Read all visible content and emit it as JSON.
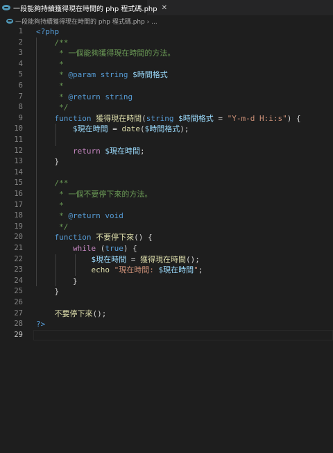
{
  "tab": {
    "title": "一段能夠持續獲得現在時間的 php 程式碼.php",
    "close": "✕"
  },
  "breadcrumb": {
    "path": "一段能夠持續獲得現在時間的 php 程式碼.php › ..."
  },
  "editor": {
    "active_line": 29,
    "lines": [
      {
        "n": "1",
        "tokens": [
          {
            "c": "t-tag",
            "t": "<?php"
          }
        ]
      },
      {
        "n": "2",
        "tokens": [
          {
            "c": "t-cm",
            "t": "    /**"
          }
        ]
      },
      {
        "n": "3",
        "tokens": [
          {
            "c": "t-cm",
            "t": "     * 一個能夠獲得現在時間的方法。"
          }
        ]
      },
      {
        "n": "4",
        "tokens": [
          {
            "c": "t-cm",
            "t": "     *"
          }
        ]
      },
      {
        "n": "5",
        "tokens": [
          {
            "c": "t-cm",
            "t": "     * "
          },
          {
            "c": "t-kw",
            "t": "@param"
          },
          {
            "c": "t-cm",
            "t": " "
          },
          {
            "c": "t-kw",
            "t": "string"
          },
          {
            "c": "t-cm",
            "t": " "
          },
          {
            "c": "t-var",
            "t": "$時間格式"
          }
        ]
      },
      {
        "n": "6",
        "tokens": [
          {
            "c": "t-cm",
            "t": "     *"
          }
        ]
      },
      {
        "n": "7",
        "tokens": [
          {
            "c": "t-cm",
            "t": "     * "
          },
          {
            "c": "t-kw",
            "t": "@return"
          },
          {
            "c": "t-cm",
            "t": " "
          },
          {
            "c": "t-kw",
            "t": "string"
          }
        ]
      },
      {
        "n": "8",
        "tokens": [
          {
            "c": "t-cm",
            "t": "     */"
          }
        ]
      },
      {
        "n": "9",
        "tokens": [
          {
            "c": "t-kw",
            "t": "    function"
          },
          {
            "c": "t-op",
            "t": " "
          },
          {
            "c": "t-fn",
            "t": "獲得現在時間"
          },
          {
            "c": "t-op",
            "t": "("
          },
          {
            "c": "t-kw",
            "t": "string"
          },
          {
            "c": "t-op",
            "t": " "
          },
          {
            "c": "t-var",
            "t": "$時間格式"
          },
          {
            "c": "t-op",
            "t": " = "
          },
          {
            "c": "t-str",
            "t": "\"Y-m-d H:i:s\""
          },
          {
            "c": "t-op",
            "t": ") {"
          }
        ]
      },
      {
        "n": "10",
        "tokens": [
          {
            "c": "t-var",
            "t": "        $現在時間"
          },
          {
            "c": "t-op",
            "t": " = "
          },
          {
            "c": "t-fn",
            "t": "date"
          },
          {
            "c": "t-op",
            "t": "("
          },
          {
            "c": "t-var",
            "t": "$時間格式"
          },
          {
            "c": "t-op",
            "t": ");"
          }
        ]
      },
      {
        "n": "11",
        "tokens": []
      },
      {
        "n": "12",
        "tokens": [
          {
            "c": "t-ctl",
            "t": "        return"
          },
          {
            "c": "t-op",
            "t": " "
          },
          {
            "c": "t-var",
            "t": "$現在時間"
          },
          {
            "c": "t-op",
            "t": ";"
          }
        ]
      },
      {
        "n": "13",
        "tokens": [
          {
            "c": "t-op",
            "t": "    }"
          }
        ]
      },
      {
        "n": "14",
        "tokens": []
      },
      {
        "n": "15",
        "tokens": [
          {
            "c": "t-cm",
            "t": "    /**"
          }
        ]
      },
      {
        "n": "16",
        "tokens": [
          {
            "c": "t-cm",
            "t": "     * 一個不要停下來的方法。"
          }
        ]
      },
      {
        "n": "17",
        "tokens": [
          {
            "c": "t-cm",
            "t": "     *"
          }
        ]
      },
      {
        "n": "18",
        "tokens": [
          {
            "c": "t-cm",
            "t": "     * "
          },
          {
            "c": "t-kw",
            "t": "@return"
          },
          {
            "c": "t-cm",
            "t": " "
          },
          {
            "c": "t-kw",
            "t": "void"
          }
        ]
      },
      {
        "n": "19",
        "tokens": [
          {
            "c": "t-cm",
            "t": "     */"
          }
        ]
      },
      {
        "n": "20",
        "tokens": [
          {
            "c": "t-kw",
            "t": "    function"
          },
          {
            "c": "t-op",
            "t": " "
          },
          {
            "c": "t-fn",
            "t": "不要停下來"
          },
          {
            "c": "t-op",
            "t": "() {"
          }
        ]
      },
      {
        "n": "21",
        "tokens": [
          {
            "c": "t-ctl",
            "t": "        while"
          },
          {
            "c": "t-op",
            "t": " ("
          },
          {
            "c": "t-kw",
            "t": "true"
          },
          {
            "c": "t-op",
            "t": ") {"
          }
        ]
      },
      {
        "n": "22",
        "tokens": [
          {
            "c": "t-var",
            "t": "            $現在時間"
          },
          {
            "c": "t-op",
            "t": " = "
          },
          {
            "c": "t-fn",
            "t": "獲得現在時間"
          },
          {
            "c": "t-op",
            "t": "();"
          }
        ]
      },
      {
        "n": "23",
        "tokens": [
          {
            "c": "t-fn",
            "t": "            echo"
          },
          {
            "c": "t-op",
            "t": " "
          },
          {
            "c": "t-str",
            "t": "\"現在時間: "
          },
          {
            "c": "t-var",
            "t": "$現在時間"
          },
          {
            "c": "t-str",
            "t": "\""
          },
          {
            "c": "t-op",
            "t": ";"
          }
        ]
      },
      {
        "n": "24",
        "tokens": [
          {
            "c": "t-op",
            "t": "        }"
          }
        ]
      },
      {
        "n": "25",
        "tokens": [
          {
            "c": "t-op",
            "t": "    }"
          }
        ]
      },
      {
        "n": "26",
        "tokens": []
      },
      {
        "n": "27",
        "tokens": [
          {
            "c": "t-fn",
            "t": "    不要停下來"
          },
          {
            "c": "t-op",
            "t": "();"
          }
        ]
      },
      {
        "n": "28",
        "tokens": [
          {
            "c": "t-tag",
            "t": "?>"
          }
        ]
      },
      {
        "n": "29",
        "tokens": []
      }
    ]
  }
}
